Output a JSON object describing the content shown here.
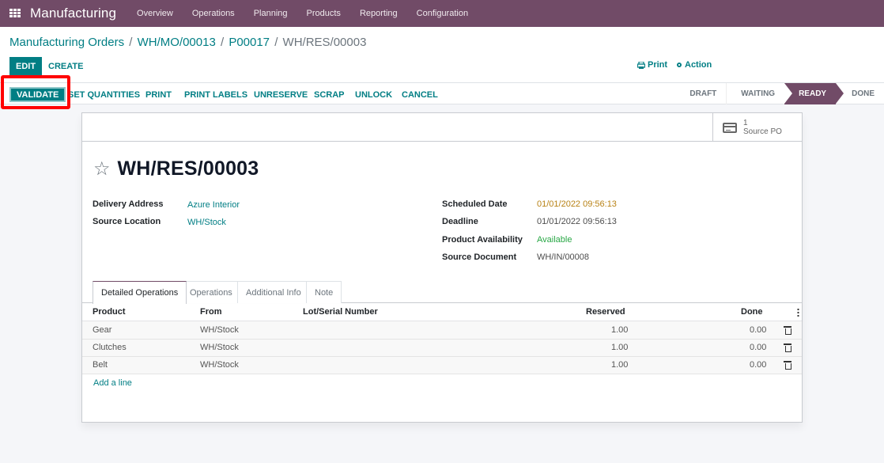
{
  "navbar": {
    "app_name": "Manufacturing",
    "menu": [
      "Overview",
      "Operations",
      "Planning",
      "Products",
      "Reporting",
      "Configuration"
    ]
  },
  "breadcrumb": {
    "items": [
      "Manufacturing Orders",
      "WH/MO/00013",
      "P00017"
    ],
    "current": "WH/RES/00003",
    "separator": "/"
  },
  "control_panel": {
    "edit_label": "EDIT",
    "create_label": "CREATE",
    "print_label": "Print",
    "action_label": "Action"
  },
  "statusbar": {
    "buttons": [
      "VALIDATE",
      "SET QUANTITIES",
      "PRINT",
      "PRINT LABELS",
      "UNRESERVE",
      "SCRAP",
      "UNLOCK",
      "CANCEL"
    ],
    "stages": [
      "DRAFT",
      "WAITING",
      "READY",
      "DONE"
    ],
    "active_stage": "READY"
  },
  "smart_button": {
    "count": "1",
    "label": "Source PO"
  },
  "record": {
    "title": "WH/RES/00003",
    "left_fields": [
      {
        "label": "Delivery Address",
        "value": "Azure Interior"
      },
      {
        "label": "Source Location",
        "value": "WH/Stock"
      }
    ],
    "right_fields": [
      {
        "label": "Scheduled Date",
        "value": "01/01/2022 09:56:13"
      },
      {
        "label": "Deadline",
        "value": "01/01/2022 09:56:13"
      },
      {
        "label": "Product Availability",
        "value": "Available"
      },
      {
        "label": "Source Document",
        "value": "WH/IN/00008"
      }
    ]
  },
  "tabs": [
    "Detailed Operations",
    "Operations",
    "Additional Info",
    "Note"
  ],
  "active_tab": "Detailed Operations",
  "table": {
    "columns": [
      "Product",
      "From",
      "Lot/Serial Number",
      "Reserved",
      "Done"
    ],
    "rows": [
      {
        "product": "Gear",
        "from": "WH/Stock",
        "lot": "",
        "reserved": "1.00",
        "done": "0.00"
      },
      {
        "product": "Clutches",
        "from": "WH/Stock",
        "lot": "",
        "reserved": "1.00",
        "done": "0.00"
      },
      {
        "product": "Belt",
        "from": "WH/Stock",
        "lot": "",
        "reserved": "1.00",
        "done": "0.00"
      }
    ],
    "add_line_label": "Add a line"
  },
  "colors": {
    "brand": "#714b67",
    "accent": "#017e84",
    "highlight": "#ff0000",
    "warning_date": "#b88215",
    "available": "#28a745"
  }
}
